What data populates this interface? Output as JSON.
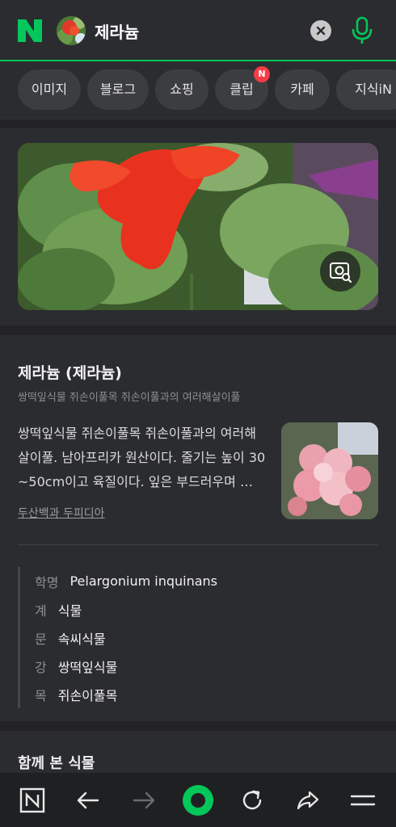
{
  "header": {
    "logo_text": "N",
    "query": "제라늄",
    "brand_color": "#03c75a"
  },
  "tabs": [
    {
      "label": "이미지"
    },
    {
      "label": "블로그"
    },
    {
      "label": "쇼핑"
    },
    {
      "label": "클립",
      "badge": "N"
    },
    {
      "label": "카페"
    },
    {
      "label": "지식iN"
    }
  ],
  "encyclopedia": {
    "title": "제라늄 (제라늄)",
    "subtitle": "쌍떡잎식물 쥐손이풀목 쥐손이풀과의 여러해살이풀",
    "description": "쌍떡잎식물 쥐손이풀목 쥐손이풀과의 여러해살이풀. 남아프리카 원산이다. 줄기는 높이 30~50cm이고 육질이다. 잎은 부드러우며 …",
    "source": "두산백과 두피디아",
    "taxonomy": [
      {
        "key": "학명",
        "value": "Pelargonium inquinans"
      },
      {
        "key": "계",
        "value": "식물"
      },
      {
        "key": "문",
        "value": "속씨식물"
      },
      {
        "key": "강",
        "value": "쌍떡잎식물"
      },
      {
        "key": "목",
        "value": "쥐손이풀목"
      }
    ]
  },
  "related": {
    "title": "함께 본 식물"
  },
  "icons": {
    "clear": "close-circle-icon",
    "mic": "microphone-icon",
    "lens": "image-search-icon",
    "nav": [
      "naver-home-icon",
      "back-arrow-icon",
      "forward-arrow-icon",
      "green-dot-icon",
      "refresh-icon",
      "share-icon",
      "menu-icon"
    ]
  }
}
